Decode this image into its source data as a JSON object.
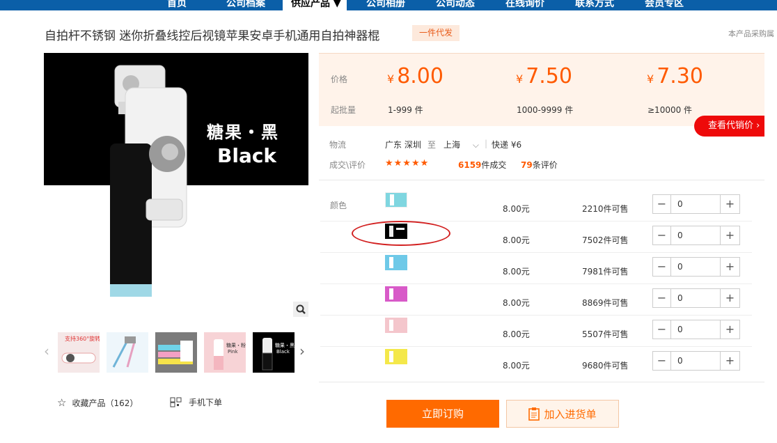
{
  "nav": {
    "items": [
      "首页",
      "公司档案",
      "供应产品 ▼",
      "公司相册",
      "公司动态",
      "在线询价",
      "联系方式",
      "会员专区"
    ]
  },
  "product": {
    "title": "自拍杆不锈钢 迷你折叠线控后视镜苹果安卓手机通用自拍神器棍",
    "badge": "一件代发",
    "side_note": "本产品采购属",
    "image_text_cn": "糖果・黑",
    "image_text_en": "Black"
  },
  "price_box": {
    "price_label": "价格",
    "moq_label": "起批量",
    "currency": "¥",
    "tiers": [
      {
        "price": "8.00",
        "qty": "1-999 件"
      },
      {
        "price": "7.50",
        "qty": "1000-9999 件"
      },
      {
        "price": "7.30",
        "qty": "≥10000 件"
      }
    ],
    "wholesale_btn": "查看代销价 ›"
  },
  "logistics": {
    "label": "物流",
    "from": "广东 深圳",
    "to_word": "至",
    "dest": "上海",
    "shipping": "快递 ¥6"
  },
  "deals": {
    "label": "成交\\评价",
    "stars": "★★★★★",
    "sold_num": "6159",
    "sold_suffix": "件成交",
    "review_num": "79",
    "review_suffix": "条评价"
  },
  "variants": {
    "label": "颜色",
    "rows": [
      {
        "price": "8.00元",
        "stock": "2210件可售",
        "qty": "0",
        "color": "#7fd6e0"
      },
      {
        "price": "8.00元",
        "stock": "7502件可售",
        "qty": "0",
        "color": "#000000"
      },
      {
        "price": "8.00元",
        "stock": "7981件可售",
        "qty": "0",
        "color": "#6ec9e8"
      },
      {
        "price": "8.00元",
        "stock": "8869件可售",
        "qty": "0",
        "color": "#d85ac8"
      },
      {
        "price": "8.00元",
        "stock": "5507件可售",
        "qty": "0",
        "color": "#f4c6cc"
      },
      {
        "price": "8.00元",
        "stock": "9680件可售",
        "qty": "0",
        "color": "#f4e84a"
      }
    ]
  },
  "thumb_texts": {
    "t1": "支持360°旋转",
    "t4": "糖果・粉",
    "t4b": "Pink",
    "t5": "糖果・黑",
    "t5b": "Black"
  },
  "actions": {
    "favorite": "收藏产品（162）",
    "mobile_order": "手机下单",
    "buy_now": "立即订购",
    "add_cart": "加入进货单"
  },
  "colors": {
    "accent_orange": "#ff5a00",
    "nav_blue": "#0b5fa8",
    "alert_red": "#ee0a0a"
  }
}
